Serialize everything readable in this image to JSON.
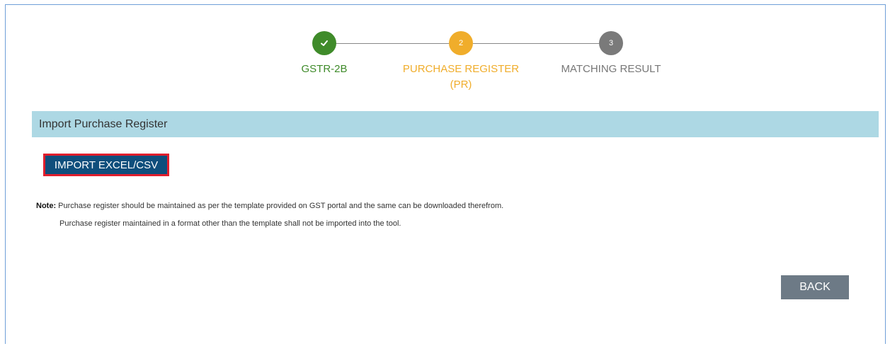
{
  "stepper": {
    "steps": [
      {
        "number": "",
        "label": "GSTR-2B",
        "status": "completed",
        "icon": "checkmark-icon",
        "color": "#3f8b2a"
      },
      {
        "number": "2",
        "label_line1": "PURCHASE REGISTER",
        "label_line2": "(PR)",
        "status": "active",
        "color": "#f0ad2b"
      },
      {
        "number": "3",
        "label": "MATCHING RESULT",
        "status": "pending",
        "color": "#7a7a7a"
      }
    ]
  },
  "panel": {
    "title": "Import Purchase Register",
    "header_color": "#add8e4"
  },
  "buttons": {
    "import_label": "IMPORT EXCEL/CSV",
    "back_label": "BACK"
  },
  "note": {
    "prefix": "Note:",
    "line1": " Purchase register should be maintained as per the template provided on GST portal and the same can be downloaded therefrom.",
    "line2": "Purchase register maintained in a format other than the template shall not be imported into the tool."
  }
}
